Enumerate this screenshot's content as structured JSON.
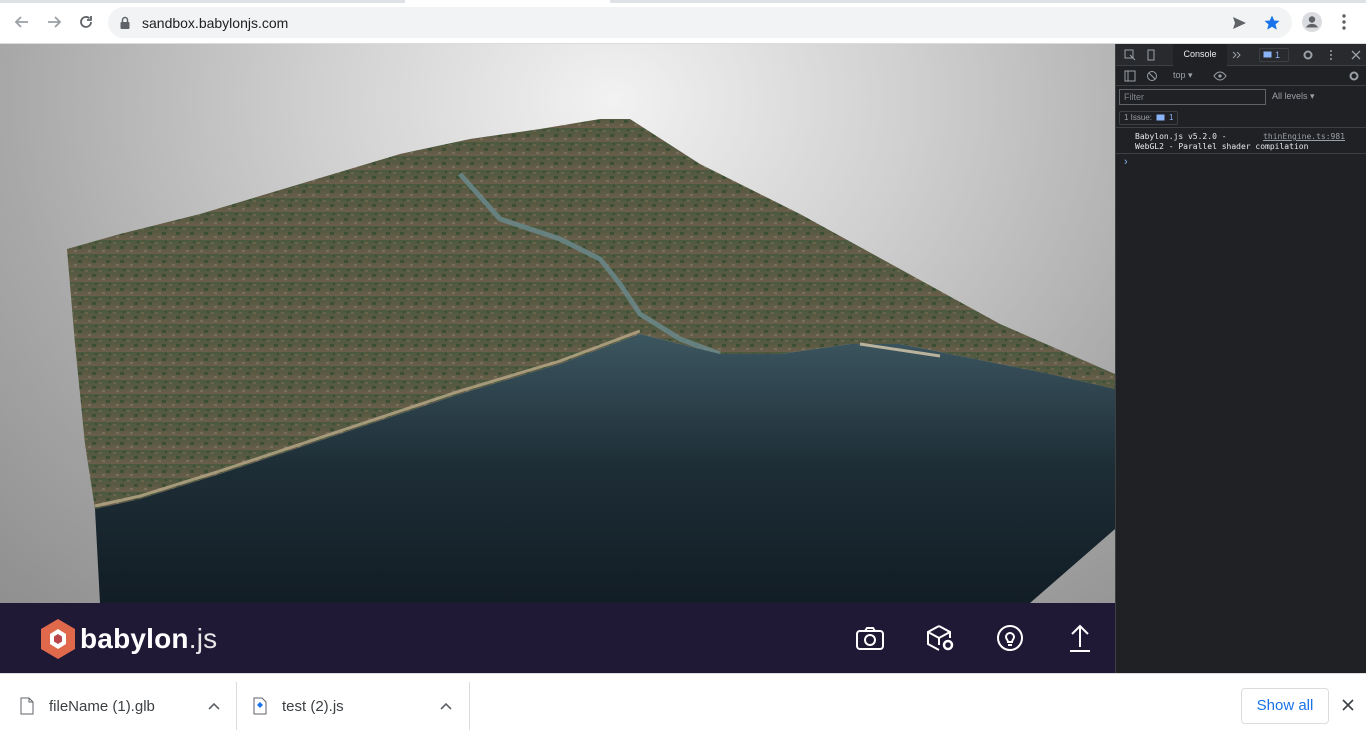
{
  "browser": {
    "url": "sandbox.babylonjs.com"
  },
  "babylon": {
    "brand_name": "babylon",
    "brand_ext": ".js"
  },
  "devtools": {
    "tab_console": "Console",
    "issues_badge_count": "1",
    "context": "top ▾",
    "filter_placeholder": "Filter",
    "levels": "All levels ▾",
    "issues_label": "1 Issue:",
    "issues_count": "1",
    "log_line1": "Babylon.js v5.2.0 -",
    "log_line2": "WebGL2 - Parallel shader compilation",
    "log_source": "thinEngine.ts:981",
    "prompt": "›"
  },
  "downloads": {
    "items": [
      {
        "name": "fileName (1).glb"
      },
      {
        "name": "test (2).js"
      }
    ],
    "show_all": "Show all"
  }
}
